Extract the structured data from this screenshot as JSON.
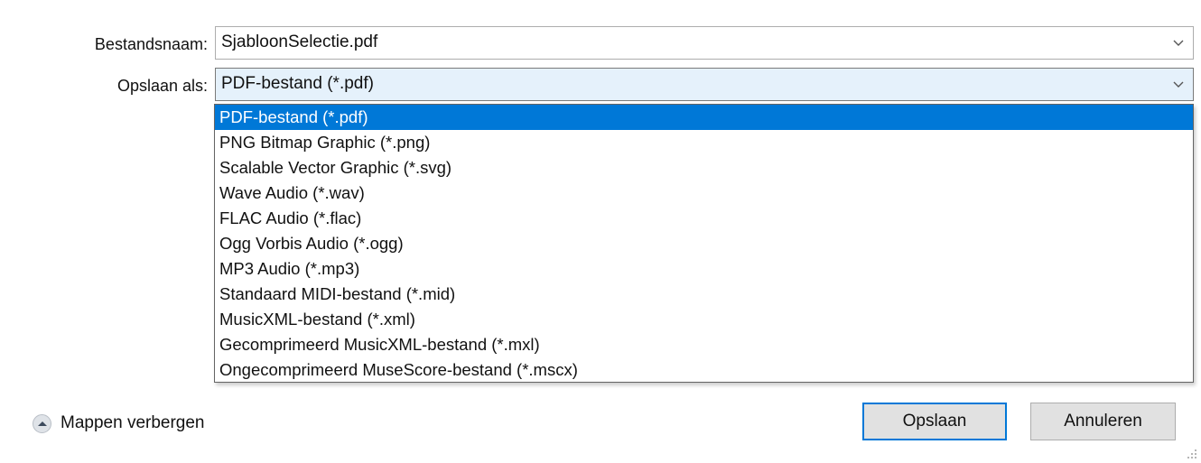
{
  "filename": {
    "label": "Bestandsnaam:",
    "value": "SjabloonSelectie.pdf"
  },
  "save_as": {
    "label": "Opslaan als:",
    "value": "PDF-bestand (*.pdf)",
    "options": [
      "PDF-bestand (*.pdf)",
      "PNG Bitmap Graphic (*.png)",
      "Scalable Vector Graphic (*.svg)",
      "Wave Audio (*.wav)",
      "FLAC Audio (*.flac)",
      "Ogg Vorbis Audio (*.ogg)",
      "MP3 Audio (*.mp3)",
      "Standaard MIDI-bestand (*.mid)",
      "MusicXML-bestand (*.xml)",
      "Gecomprimeerd MusicXML-bestand (*.mxl)",
      "Ongecomprimeerd MuseScore-bestand (*.mscx)"
    ],
    "highlighted_index": 0
  },
  "folders_toggle": {
    "label": "Mappen verbergen",
    "icon": "chevron-up-icon"
  },
  "buttons": {
    "save": "Opslaan",
    "cancel": "Annuleren"
  },
  "colors": {
    "highlight": "#0078d7",
    "selected_combo_bg": "#e5f1fb"
  }
}
